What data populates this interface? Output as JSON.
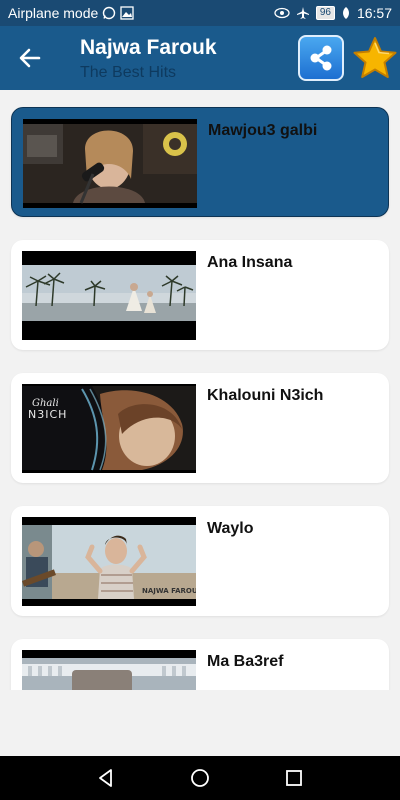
{
  "status_bar": {
    "left_text": "Airplane mode",
    "battery": "96",
    "time": "16:57"
  },
  "app_bar": {
    "title": "Najwa Farouk",
    "subtitle": "The Best Hits"
  },
  "songs": [
    {
      "title": "Mawjou3 galbi",
      "active": true
    },
    {
      "title": "Ana Insana",
      "active": false
    },
    {
      "title": "Khalouni N3ich",
      "active": false,
      "thumb_overlay": "Ghali\nN3ICH"
    },
    {
      "title": "Waylo",
      "active": false,
      "thumb_overlay": "NAJWA FAROUK"
    },
    {
      "title": "Ma Ba3ref",
      "active": false
    }
  ],
  "colors": {
    "status_bar": "#1a4a73",
    "app_bar": "#1a5a8c",
    "active_card": "#1a5a8c",
    "star": "#f7b500"
  },
  "icons": [
    "back-arrow-icon",
    "share-icon",
    "star-icon",
    "whatsapp-icon",
    "gallery-icon",
    "eye-icon",
    "airplane-icon",
    "leaf-icon",
    "nav-back-icon",
    "nav-home-icon",
    "nav-recents-icon"
  ]
}
